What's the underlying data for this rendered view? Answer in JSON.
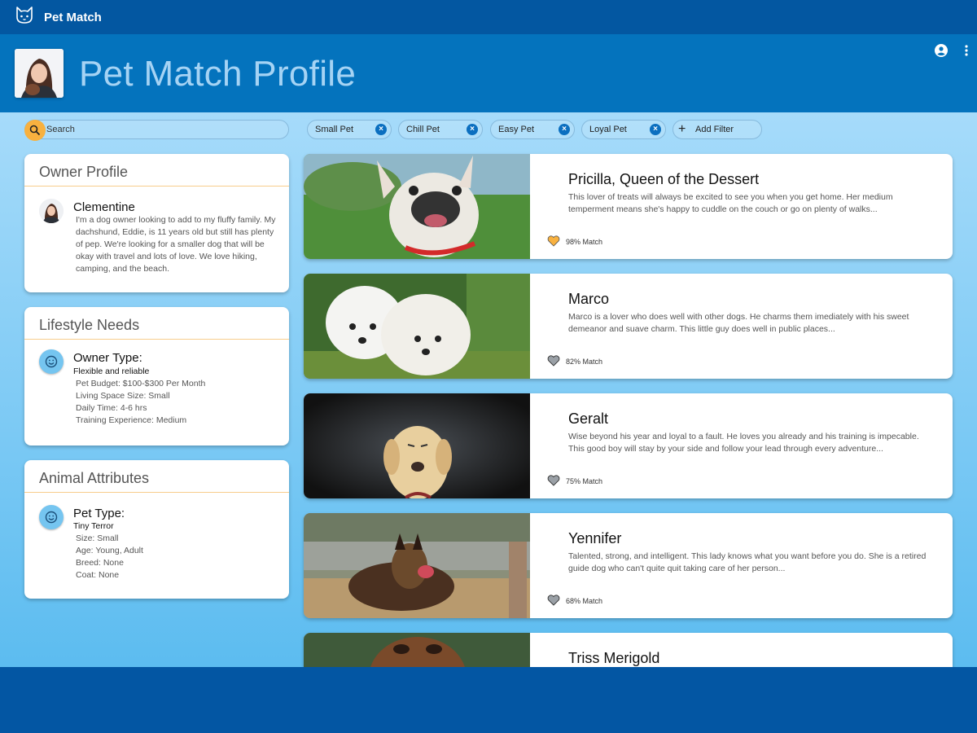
{
  "app": {
    "title": "Pet Match"
  },
  "header": {
    "title": "Pet Match Profile"
  },
  "search": {
    "label": "Search"
  },
  "filters": {
    "chips": [
      "Small Pet",
      "Chill Pet",
      "Easy Pet",
      "Loyal Pet"
    ],
    "add_label": "Add Filter"
  },
  "owner_profile": {
    "title": "Owner Profile",
    "name": "Clementine",
    "bio": "I'm a dog owner looking to add to my fluffy family. My dachshund, Eddie, is 11 years old but still has plenty of pep. We're looking for a smaller dog that will be okay with travel and lots of love. We love hiking, camping, and the beach."
  },
  "lifestyle": {
    "title": "Lifestyle Needs",
    "heading": "Owner Type:",
    "subheading": "Flexible and reliable",
    "lines": [
      "Pet Budget: $100-$300 Per Month",
      "Living Space Size: Small",
      "Daily Time: 4-6 hrs",
      "Training Experience: Medium"
    ]
  },
  "attributes": {
    "title": "Animal Attributes",
    "heading": "Pet Type:",
    "subheading": "Tiny Terror",
    "lines": [
      "Size: Small",
      "Age: Young, Adult",
      "Breed: None",
      "Coat: None"
    ]
  },
  "pets": [
    {
      "name": "Pricilla, Queen of the Dessert",
      "desc": "This lover of treats will always be excited to see you when you get home. Her medium temperment means she's happy to cuddle on the couch or go on plenty of walks...",
      "match": "98% Match",
      "favorite": true
    },
    {
      "name": "Marco",
      "desc": "Marco is a lover who does well with other dogs. He charms them imediately with his sweet demeanor and suave charm. This little guy does well in public places...",
      "match": "82% Match",
      "favorite": false
    },
    {
      "name": "Geralt",
      "desc": "Wise beyond his year and loyal to a fault. He loves you already and his training is impecable. This good boy will stay by your side and follow your lead through every adventure...",
      "match": "75% Match",
      "favorite": false
    },
    {
      "name": "Yennifer",
      "desc": "Talented, strong, and intelligent. This lady knows what you want before you do. She is a retired guide dog who can't quite quit taking care of her person...",
      "match": "68% Match",
      "favorite": false
    },
    {
      "name": "Triss Merigold",
      "desc": "",
      "match": "",
      "favorite": false
    }
  ],
  "colors": {
    "accent": "#f8b13f",
    "primary": "#0473bd",
    "appbar": "#0357a1",
    "divider": "#f8cd8c"
  }
}
